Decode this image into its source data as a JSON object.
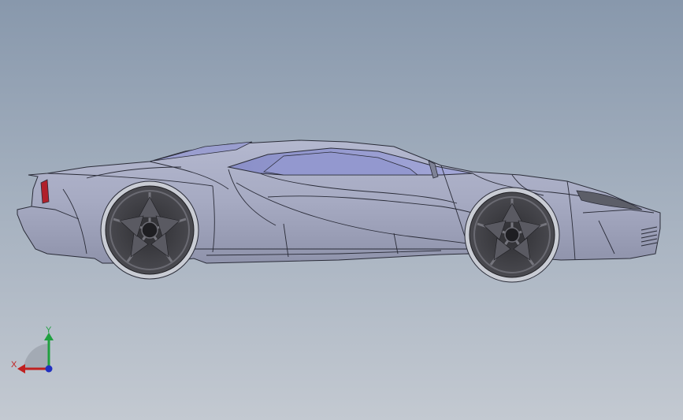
{
  "viewport": {
    "background_top": "#8898ac",
    "background_bottom": "#c3c9d1"
  },
  "model": {
    "body_color": "#a6aac2",
    "body_shadow_color": "#8c90a8",
    "glass_color": "#8f94cc",
    "edge_color": "#2a2c38",
    "wheel_color": "#3a3a3e",
    "tire_color": "#c9ccd4",
    "taillight_color": "#b0202a"
  },
  "triad": {
    "x_label": "X",
    "y_label": "Y",
    "x_color": "#c02020",
    "y_color": "#20a040",
    "z_color": "#2030c0"
  }
}
